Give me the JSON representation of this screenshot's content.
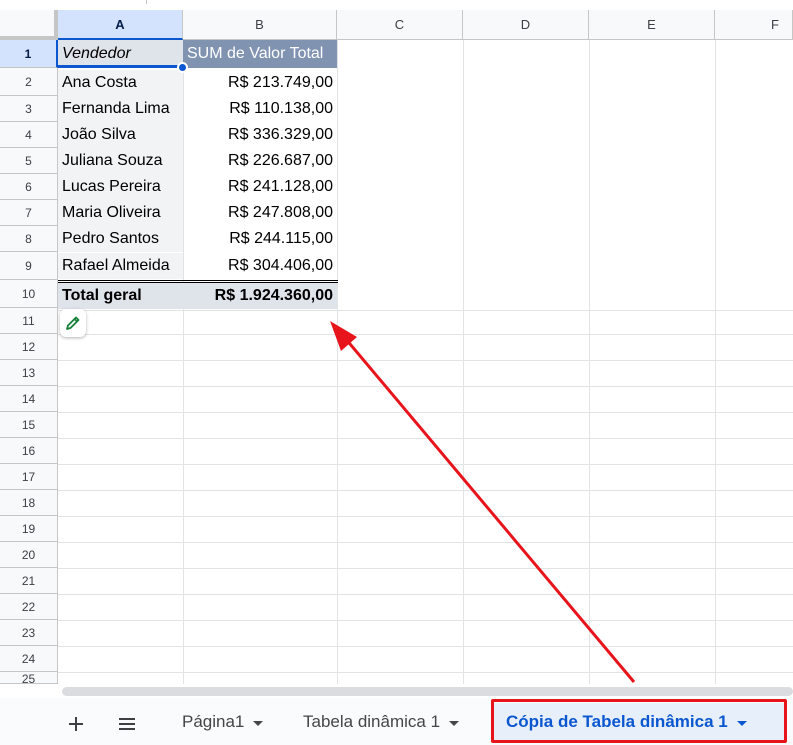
{
  "columns": [
    "A",
    "B",
    "C",
    "D",
    "E",
    "F"
  ],
  "rows": [
    "1",
    "2",
    "3",
    "4",
    "5",
    "6",
    "7",
    "8",
    "9",
    "10",
    "11",
    "12",
    "13",
    "14",
    "15",
    "16",
    "17",
    "18",
    "19",
    "20",
    "21",
    "22",
    "23",
    "24",
    "25"
  ],
  "pivot": {
    "header": {
      "vendedor": "Vendedor",
      "sum": "SUM de Valor Total"
    },
    "rows": [
      {
        "name": "Ana Costa",
        "value": "R$ 213.749,00"
      },
      {
        "name": "Fernanda Lima",
        "value": "R$ 110.138,00"
      },
      {
        "name": "João Silva",
        "value": "R$ 336.329,00"
      },
      {
        "name": "Juliana Souza",
        "value": "R$ 226.687,00"
      },
      {
        "name": "Lucas Pereira",
        "value": "R$ 241.128,00"
      },
      {
        "name": "Maria Oliveira",
        "value": "R$ 247.808,00"
      },
      {
        "name": "Pedro Santos",
        "value": "R$ 244.115,00"
      },
      {
        "name": "Rafael Almeida",
        "value": "R$ 304.406,00"
      }
    ],
    "total": {
      "label": "Total geral",
      "value": "R$ 1.924.360,00"
    }
  },
  "pencil_icon": "pencil-icon",
  "sheetbar": {
    "add_icon": "plus-icon",
    "menu_icon": "all-sheets-icon",
    "tabs": [
      {
        "label": "Página1"
      },
      {
        "label": "Tabela dinâmica 1"
      },
      {
        "label": "Cópia de Tabela dinâmica 1"
      }
    ],
    "active_tab": "Cópia de Tabela dinâmica 1"
  },
  "colors": {
    "accent": "#0b57d0",
    "annotation": "#e8141c",
    "pivot_header": "#8093b1"
  }
}
